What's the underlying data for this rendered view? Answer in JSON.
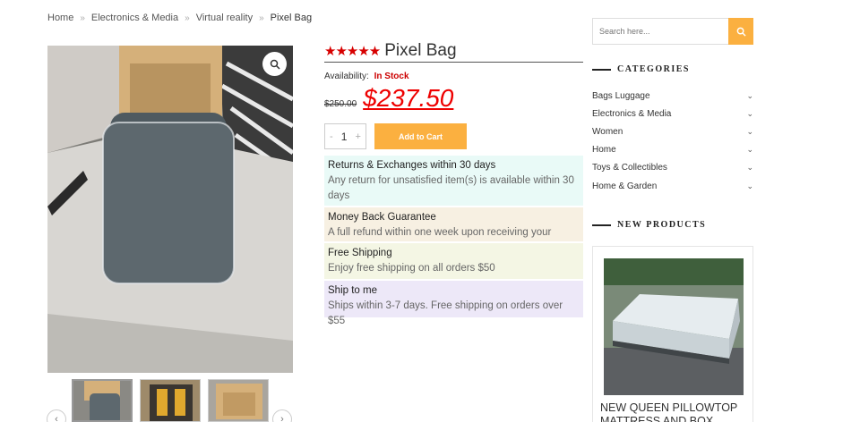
{
  "breadcrumb": {
    "items": [
      "Home",
      "Electronics & Media",
      "Virtual reality"
    ],
    "separator": "»",
    "current": "Pixel Bag"
  },
  "product": {
    "stars": "★★★★★",
    "title": "Pixel Bag",
    "availability_label": "Availability:",
    "availability_value": "In Stock",
    "old_price": "$250.00",
    "price": "$237.50",
    "quantity": "1",
    "qty_minus": "-",
    "qty_plus": "+",
    "add_to_cart": "Add to Cart"
  },
  "info_blocks": [
    {
      "heading": "Returns & Exchanges within 30 days",
      "text": "Any return for unsatisfied item(s) is available within 30 days"
    },
    {
      "heading": "Money Back Guarantee",
      "text": "A full refund within one week upon receiving your return"
    },
    {
      "heading": "Free Shipping",
      "text": "Enjoy free shipping on all orders $50"
    },
    {
      "heading": "Ship to me",
      "text": "Ships within 3-7 days. Free shipping on orders over $55"
    }
  ],
  "sidebar": {
    "search_placeholder": "Search here...",
    "categories_title": "CATEGORIES",
    "categories": [
      "Bags Luggage",
      "Electronics & Media",
      "Women",
      "Home",
      "Toys & Collectibles",
      "Home & Garden"
    ],
    "new_products_title": "NEW PRODUCTS",
    "new_product_name": "NEW QUEEN PILLOWTOP MATTRESS AND BOX"
  },
  "icons": {
    "zoom": "magnifier-icon",
    "search": "search-icon",
    "chevron": "chevron-down-icon",
    "thumb_prev": "chevron-left-icon",
    "thumb_next": "chevron-right-icon"
  },
  "colors": {
    "accent": "#fbb040",
    "price": "#ee0000",
    "stock": "#cc0000",
    "stars": "#d70000"
  }
}
